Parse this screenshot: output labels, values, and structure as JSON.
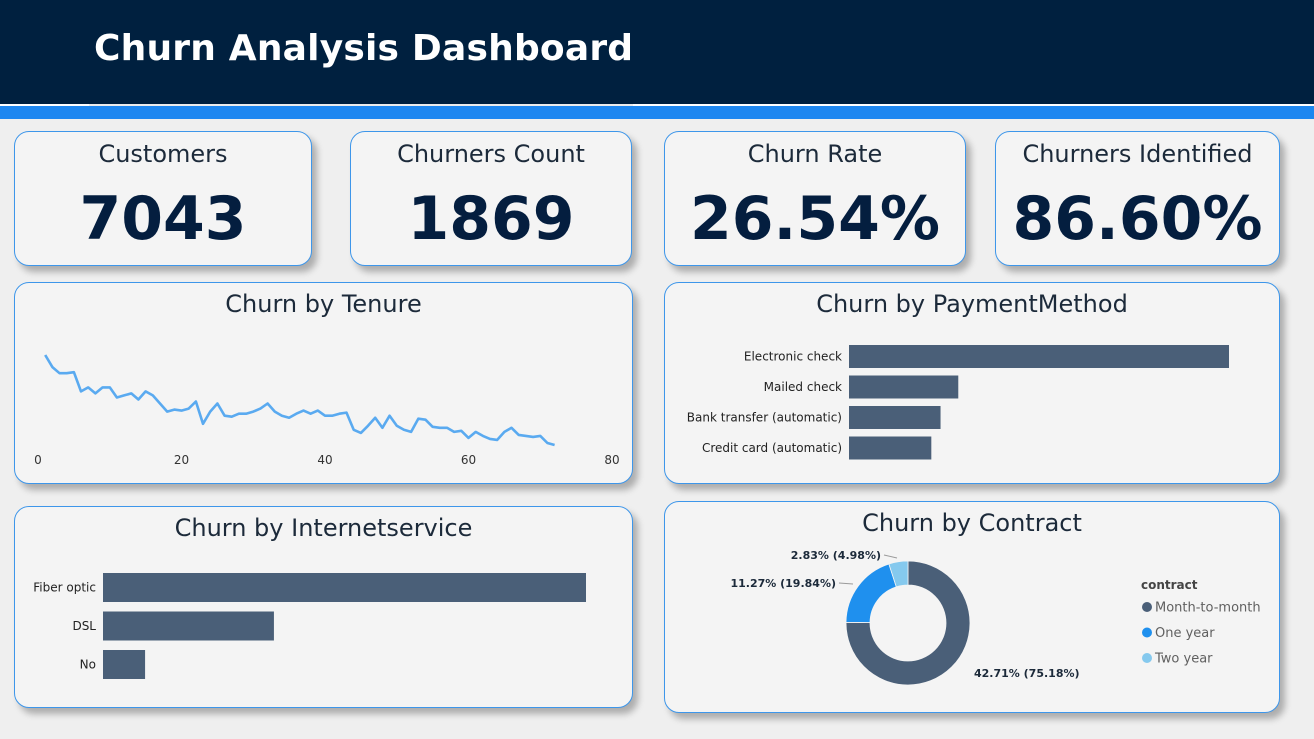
{
  "header": {
    "title": "Churn Analysis Dashboard"
  },
  "kpis": [
    {
      "label": "Customers",
      "value": "7043"
    },
    {
      "label": "Churners Count",
      "value": "1869"
    },
    {
      "label": "Churn Rate",
      "value": "26.54%"
    },
    {
      "label": "Churners Identified",
      "value": "86.60%"
    }
  ],
  "chart_data": [
    {
      "type": "line",
      "title": "Churn by Tenure",
      "xlabel": "",
      "ylabel": "",
      "xlim": [
        0,
        80
      ],
      "x_ticks": [
        "0",
        "20",
        "40",
        "60",
        "80"
      ],
      "color": "#5aaaf0",
      "grid": false,
      "x": [
        1,
        2,
        3,
        4,
        5,
        6,
        7,
        8,
        9,
        10,
        11,
        12,
        13,
        14,
        15,
        16,
        17,
        18,
        19,
        20,
        21,
        22,
        23,
        24,
        25,
        26,
        27,
        28,
        29,
        30,
        31,
        32,
        33,
        34,
        35,
        36,
        37,
        38,
        39,
        40,
        41,
        42,
        43,
        44,
        45,
        46,
        47,
        48,
        49,
        50,
        51,
        52,
        53,
        54,
        55,
        56,
        57,
        58,
        59,
        60,
        61,
        62,
        63,
        64,
        65,
        66,
        67,
        68,
        69,
        70,
        71,
        72
      ],
      "values": [
        100,
        88,
        82,
        82,
        83,
        64,
        68,
        62,
        68,
        68,
        58,
        60,
        62,
        56,
        64,
        60,
        52,
        44,
        46,
        45,
        47,
        54,
        32,
        44,
        52,
        40,
        39,
        42,
        42,
        44,
        47,
        52,
        44,
        40,
        38,
        42,
        45,
        42,
        45,
        40,
        40,
        42,
        43,
        26,
        23,
        30,
        38,
        28,
        40,
        30,
        26,
        24,
        37,
        36,
        29,
        28,
        28,
        24,
        25,
        18,
        24,
        20,
        17,
        16,
        24,
        28,
        21,
        20,
        19,
        20,
        13,
        11
      ]
    },
    {
      "type": "bar",
      "orientation": "horizontal",
      "title": "Churn by PaymentMethod",
      "categories": [
        "Electronic check",
        "Mailed check",
        "Bank transfer (automatic)",
        "Credit card (automatic)"
      ],
      "values": [
        1071,
        308,
        258,
        232
      ],
      "color": "#4a5f78"
    },
    {
      "type": "bar",
      "orientation": "horizontal",
      "title": "Churn by Internetservice",
      "categories": [
        "Fiber optic",
        "DSL",
        "No"
      ],
      "values": [
        1297,
        459,
        113
      ],
      "color": "#4a5f78"
    },
    {
      "type": "pie",
      "donut": true,
      "title": "Churn by Contract",
      "legend_title": "contract",
      "legend_position": "right",
      "categories": [
        "Month-to-month",
        "One year",
        "Two year"
      ],
      "values": [
        75.18,
        19.84,
        4.98
      ],
      "data_labels": [
        "42.71% (75.18%)",
        "11.27% (19.84%)",
        "2.83% (4.98%)"
      ],
      "colors": [
        "#4a5f78",
        "#1f90ee",
        "#85c9ee"
      ]
    }
  ]
}
